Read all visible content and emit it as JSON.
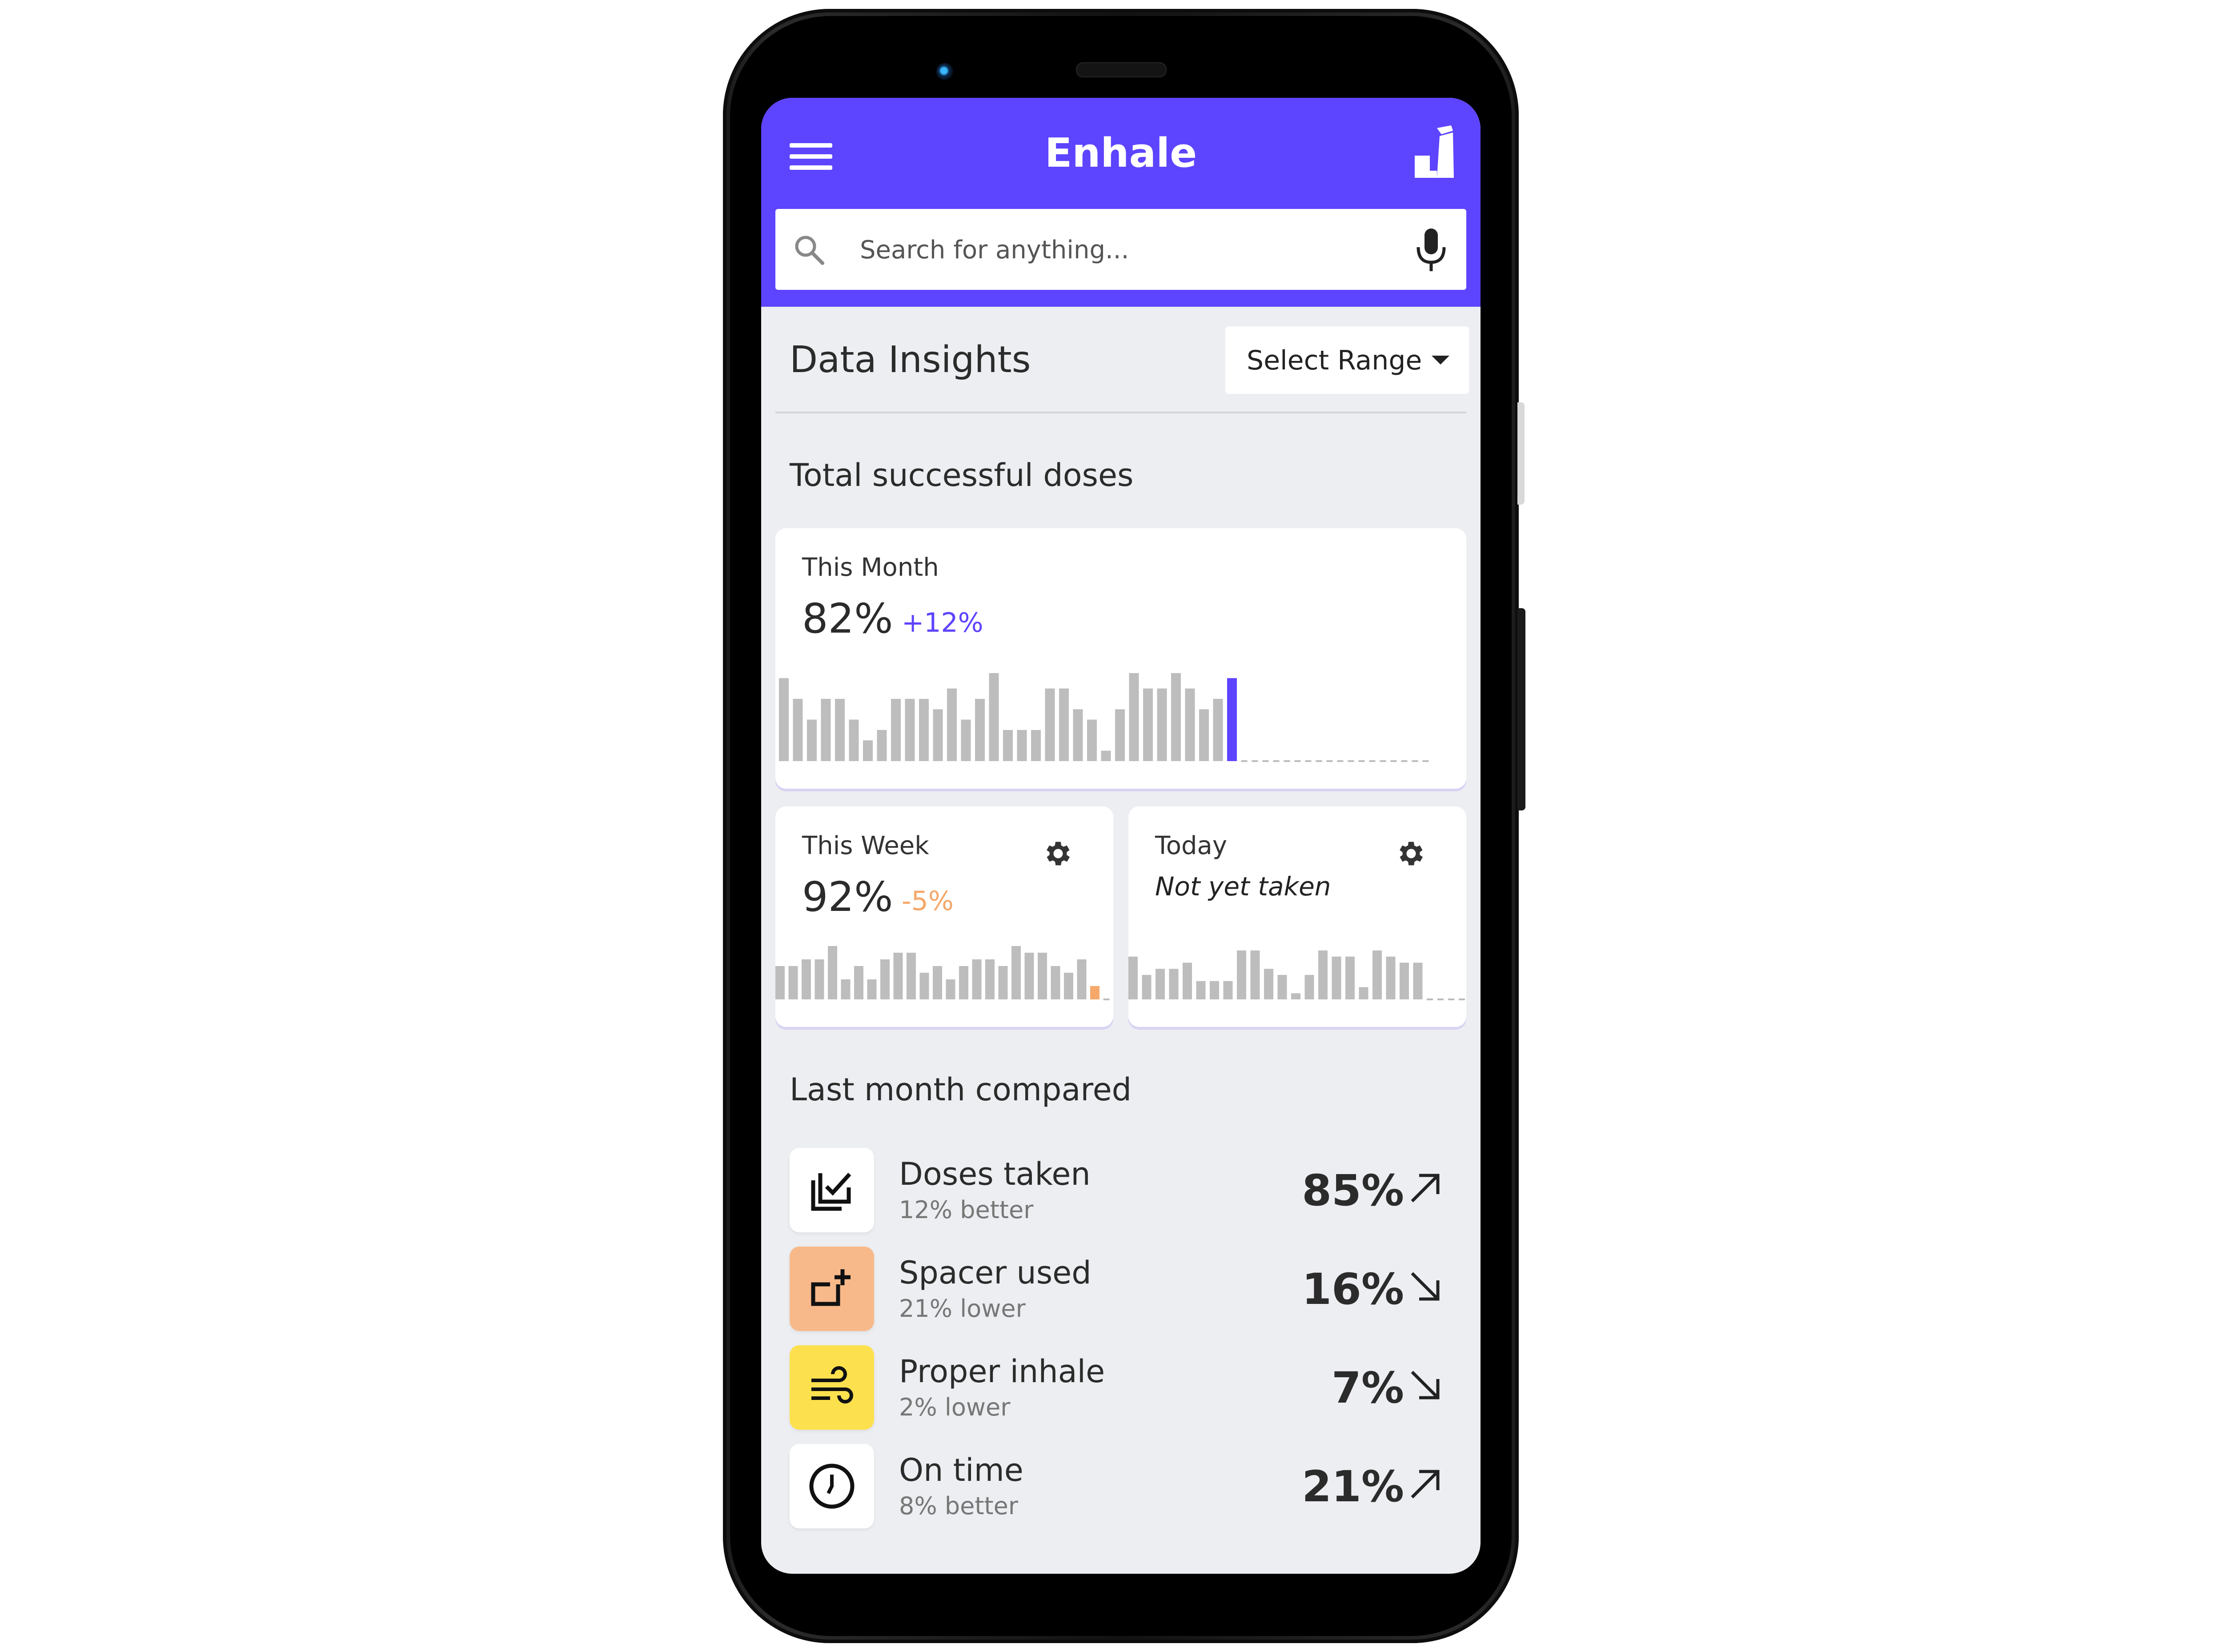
{
  "app": {
    "title": "Enhale"
  },
  "search": {
    "placeholder": "Search for anything..."
  },
  "insights": {
    "title": "Data Insights",
    "range_label": "Select Range",
    "divider": ""
  },
  "doses": {
    "section_title": "Total successful doses",
    "month": {
      "label": "This Month",
      "value": "82%",
      "change": "+12%",
      "change_color": "#5d44fe",
      "bars": [
        8,
        6,
        4,
        6,
        6,
        4,
        2,
        3,
        6,
        6,
        6,
        5,
        7,
        4,
        6,
        9,
        3,
        3,
        3,
        7,
        7,
        5,
        4,
        1,
        5,
        9,
        7,
        7,
        9,
        7,
        5,
        6,
        8
      ],
      "highlight_color": "#5d44fe"
    },
    "week": {
      "label": "This Week",
      "value": "92%",
      "change": "-5%",
      "change_color": "#f5a86a",
      "bars": [
        5,
        5,
        6,
        6,
        8,
        3,
        5,
        3,
        6,
        7,
        7,
        4,
        5,
        3,
        5,
        6,
        6,
        5,
        8,
        7,
        7,
        5,
        4,
        6,
        2
      ],
      "highlight_color": "#f5a86a"
    },
    "today": {
      "label": "Today",
      "note": "Not yet taken",
      "bars": [
        7,
        4,
        5,
        5,
        6,
        3,
        3,
        3,
        8,
        8,
        5,
        4,
        1,
        4,
        8,
        7,
        7,
        2,
        8,
        7,
        6,
        6
      ]
    }
  },
  "comparison": {
    "section_title": "Last month compared",
    "items": [
      {
        "title": "Doses taken",
        "subtitle": "12% better",
        "value": "85%",
        "trend": "up",
        "icon": "checklist-icon",
        "icon_bg": "#ffffff"
      },
      {
        "title": "Spacer used",
        "subtitle": "21% lower",
        "value": "16%",
        "trend": "down",
        "icon": "spacer-icon",
        "icon_bg": "#f8b98a"
      },
      {
        "title": "Proper inhale",
        "subtitle": "2% lower",
        "value": "7%",
        "trend": "down",
        "icon": "wind-icon",
        "icon_bg": "#fde04e"
      },
      {
        "title": "On time",
        "subtitle": "8% better",
        "value": "21%",
        "trend": "up",
        "icon": "clock-icon",
        "icon_bg": "#ffffff"
      }
    ]
  },
  "colors": {
    "brand": "#5d44fe",
    "background": "#eceef1",
    "bar": "#bdbdbd"
  }
}
